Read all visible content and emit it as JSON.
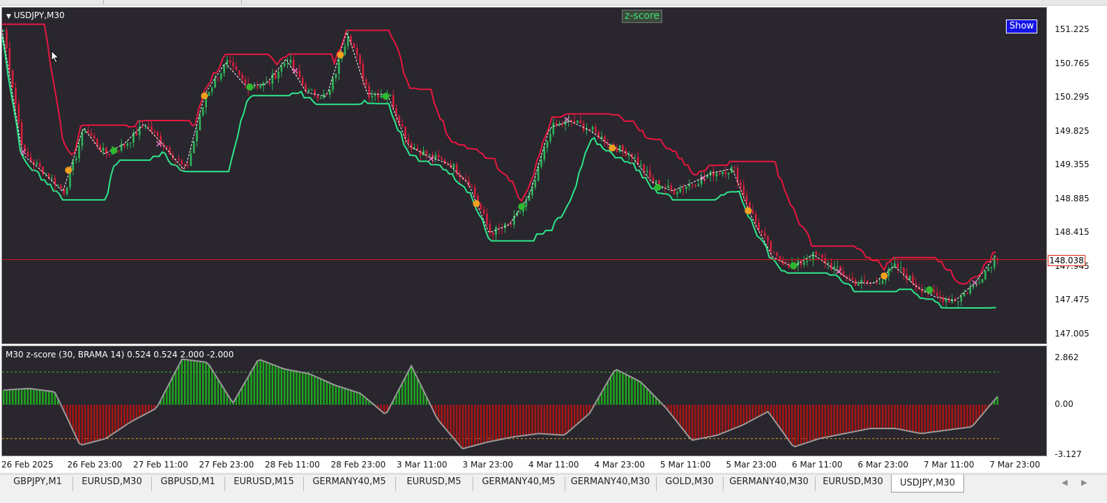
{
  "chart": {
    "symbol": "USDJPY,M30",
    "indicator_badge": "z-score",
    "show_button": "Show",
    "current_price": "148.038",
    "price_axis": [
      "151.225",
      "150.765",
      "150.295",
      "149.825",
      "149.355",
      "148.885",
      "148.415",
      "147.945",
      "147.475",
      "147.005"
    ],
    "time_axis": [
      "26 Feb 2025",
      "26 Feb 23:00",
      "27 Feb 11:00",
      "27 Feb 23:00",
      "28 Feb 11:00",
      "28 Feb 23:00",
      "3 Mar 11:00",
      "3 Mar 23:00",
      "4 Mar 11:00",
      "4 Mar 23:00",
      "5 Mar 11:00",
      "5 Mar 23:00",
      "6 Mar 11:00",
      "6 Mar 23:00",
      "7 Mar 11:00",
      "7 Mar 23:00"
    ]
  },
  "indicator": {
    "label": "M30 z-score (30, BRAMA 14) 0.524 0.524 2.000 -2.000",
    "axis": [
      "2.862",
      "0.00",
      "-3.127"
    ]
  },
  "tabs": [
    "GBPJPY,M1",
    "EURUSD,M30",
    "GBPUSD,M1",
    "EURUSD,M15",
    "GERMANY40,M5",
    "EURUSD,M5",
    "GERMANY40,M5",
    "GERMANY40,M30",
    "GOLD,M30",
    "GERMANY40,M30",
    "EURUSD,M30",
    "USDJPY,M30"
  ],
  "active_tab": "USDJPY,M30",
  "scroll": {
    "left": "◀",
    "right": "▶"
  },
  "icons": {
    "dropdown": "triangle-down-icon",
    "cursor": "mouse-pointer-icon"
  },
  "colors": {
    "bull": "#2fb85a",
    "bear": "#d8203c",
    "upper_band": "#e8163f",
    "lower_band": "#2de88a",
    "pos_hist": "#1ea81e",
    "neg_hist": "#aa1414",
    "zline": "#9a9a9a",
    "price_line": "#e01818",
    "panel_bg": "#29262e"
  },
  "chart_data": {
    "type": "candlestick",
    "price_waypoints": [
      151.225,
      149.5,
      149.26,
      148.98,
      149.87,
      149.5,
      149.64,
      149.92,
      149.61,
      149.27,
      150.34,
      150.77,
      150.45,
      150.47,
      150.82,
      150.36,
      150.3,
      151.21,
      150.34,
      150.33,
      149.63,
      149.47,
      149.37,
      149.09,
      148.41,
      148.52,
      148.93,
      149.87,
      149.96,
      149.83,
      149.62,
      149.49,
      149.12,
      148.99,
      149.1,
      149.24,
      149.3,
      148.6,
      148.07,
      147.94,
      148.11,
      147.91,
      147.72,
      147.71,
      147.95,
      147.68,
      147.52,
      147.47,
      147.73,
      148.1
    ],
    "zscore_waypoints": [
      0.9,
      1.0,
      0.8,
      -2.4,
      -2.0,
      -1.0,
      -0.2,
      2.8,
      2.6,
      0.1,
      2.8,
      2.2,
      1.9,
      1.2,
      0.7,
      -0.6,
      2.4,
      -0.8,
      -2.6,
      -2.2,
      -1.9,
      -1.7,
      -1.8,
      -0.5,
      2.2,
      1.4,
      -0.2,
      -2.1,
      -1.8,
      -1.2,
      -0.4,
      -2.5,
      -2.0,
      -1.7,
      -1.4,
      -1.4,
      -1.7,
      -1.5,
      -1.3,
      0.5
    ]
  }
}
